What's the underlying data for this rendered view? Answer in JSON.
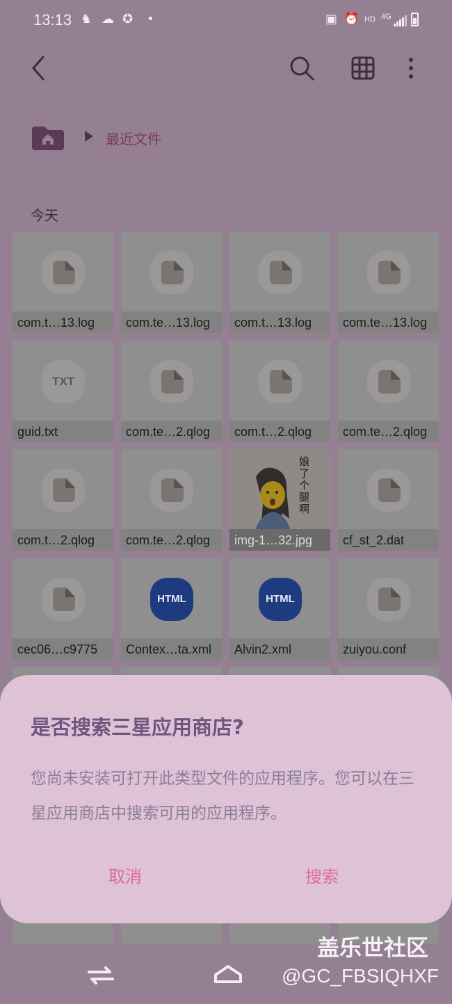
{
  "status_bar": {
    "time": "13:13",
    "hd": "HD",
    "network": "4G"
  },
  "toolbar": {
    "back_icon": "chevron-left-icon",
    "search_icon": "search-icon",
    "view_icon": "grid-view-icon",
    "more_icon": "more-vertical-icon"
  },
  "breadcrumb": {
    "current": "最近文件"
  },
  "section": {
    "title": "今天"
  },
  "files": [
    {
      "name": "com.t…13.log",
      "type": "doc"
    },
    {
      "name": "com.te…13.log",
      "type": "doc"
    },
    {
      "name": "com.t…13.log",
      "type": "doc"
    },
    {
      "name": "com.te…13.log",
      "type": "doc"
    },
    {
      "name": "guid.txt",
      "type": "txt",
      "glyph": "TXT"
    },
    {
      "name": "com.te…2.qlog",
      "type": "doc"
    },
    {
      "name": "com.t…2.qlog",
      "type": "doc"
    },
    {
      "name": "com.te…2.qlog",
      "type": "doc"
    },
    {
      "name": "com.t…2.qlog",
      "type": "doc"
    },
    {
      "name": "com.te…2.qlog",
      "type": "doc"
    },
    {
      "name": "img-1…32.jpg",
      "type": "image",
      "image_text": "娘了个腿啊"
    },
    {
      "name": "cf_st_2.dat",
      "type": "doc"
    },
    {
      "name": "cec06…c9775",
      "type": "doc"
    },
    {
      "name": "Contex…ta.xml",
      "type": "html",
      "glyph": "HTML"
    },
    {
      "name": "Alvin2.xml",
      "type": "html",
      "glyph": "HTML"
    },
    {
      "name": "zuiyou.conf",
      "type": "doc"
    }
  ],
  "dialog": {
    "title": "是否搜索三星应用商店?",
    "body": "您尚未安装可打开此类型文件的应用程序。您可以在三星应用商店中搜索可用的应用程序。",
    "cancel": "取消",
    "confirm": "搜索"
  },
  "watermark": {
    "line1": "盖乐世社区",
    "line2": "@GC_FBSIQHXF"
  },
  "colors": {
    "overlay_background": "#957f93",
    "dialog_background": "#dec3d7",
    "button_text": "#e06898",
    "breadcrumb_text": "#7b3c5c"
  }
}
